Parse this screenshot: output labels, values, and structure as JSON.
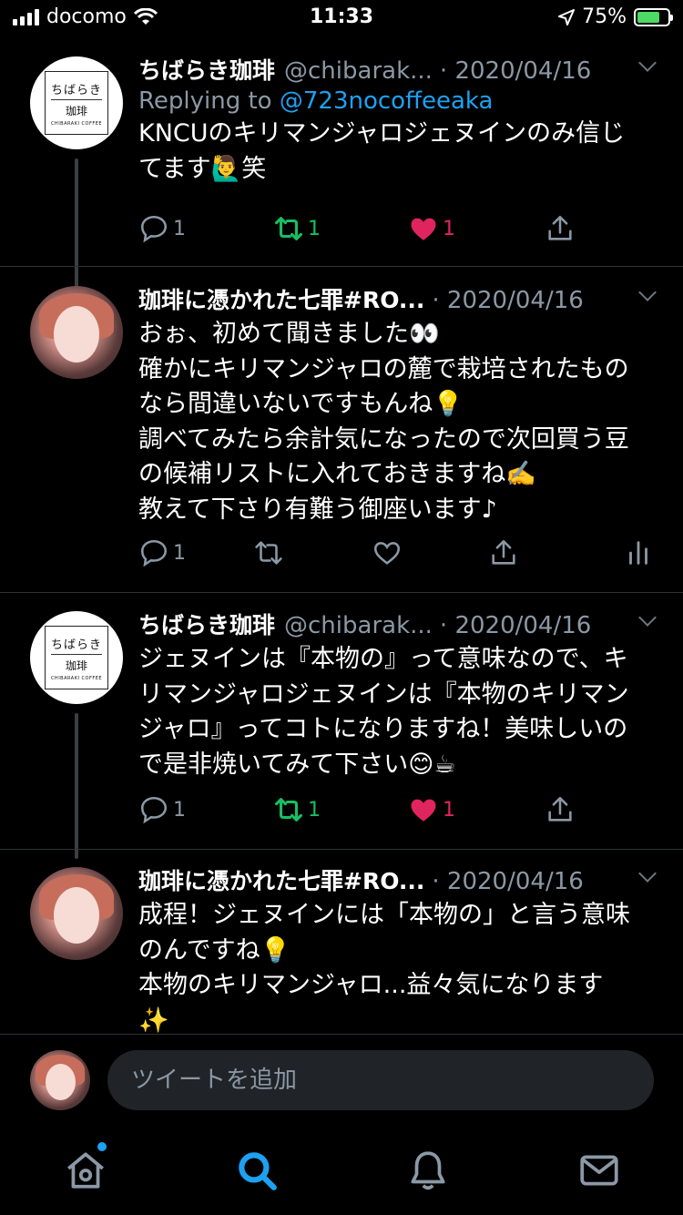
{
  "status_bar": {
    "carrier": "docomo",
    "time": "11:33",
    "battery": "75%",
    "battery_level": 0.75
  },
  "tweets": [
    {
      "name": "ちばらき珈琲",
      "handle": "@chibarak...",
      "date": "· 2020/04/16",
      "reply_prefix": "Replying to",
      "reply_handle": "@723nocoffeeaka",
      "lines": [
        "KNCUのキリマンジャロジェヌインのみ信じ",
        "てます🙋‍♂️笑"
      ],
      "reply_count": "1",
      "retweet_count": "1",
      "like_count": "1",
      "avatar_logo_top": "ちばらき",
      "avatar_logo_bottom": "珈琲",
      "avatar_logo_small": "CHIBARAKI COFFEE"
    },
    {
      "name": "珈琲に憑かれた七罪#RO...",
      "date": "· 2020/04/16",
      "lines": [
        "おぉ、初めて聞きました👀",
        "確かにキリマンジャロの麓で栽培されたもの",
        "なら間違いないですもんね💡",
        "調べてみたら余計気になったので次回買う豆",
        "の候補リストに入れておきますね✍️",
        "教えて下さり有難う御座います♪"
      ],
      "reply_count": "1"
    },
    {
      "name": "ちばらき珈琲",
      "handle": "@chibarak...",
      "date": "· 2020/04/16",
      "lines": [
        "ジェヌインは『本物の』って意味なので、キ",
        "リマンジャロジェヌインは『本物のキリマン",
        "ジャロ』ってコトになりますね！美味しいの",
        "で是非焼いてみて下さい😊☕"
      ],
      "reply_count": "1",
      "retweet_count": "1",
      "like_count": "1",
      "avatar_logo_top": "ちばらき",
      "avatar_logo_bottom": "珈琲",
      "avatar_logo_small": "CHIBARAKI COFFEE"
    },
    {
      "name": "珈琲に憑かれた七罪#RO...",
      "date": "· 2020/04/16",
      "lines": [
        "成程！ジェヌインには「本物の」と言う意味",
        "のんですね💡",
        "本物のキリマンジャロ...益々気になります",
        "✨"
      ]
    }
  ],
  "compose": {
    "placeholder": "ツイートを追加"
  },
  "tabbar": {
    "items": [
      "home-icon",
      "search-icon",
      "notifications-icon",
      "messages-icon"
    ],
    "active": "search-icon",
    "accent": "#1da1f2"
  },
  "colors": {
    "like": "#e0245e",
    "retweet": "#17bf63",
    "link": "#1da1f2",
    "muted": "#8b98a5"
  }
}
